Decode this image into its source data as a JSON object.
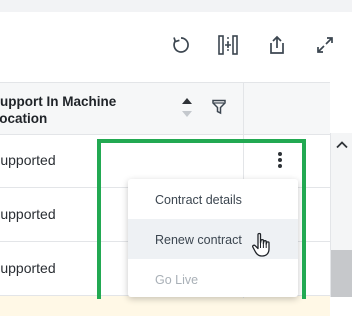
{
  "toolbar": {
    "refresh_icon": "refresh-icon",
    "columns_icon": "column-insert-icon",
    "export_icon": "export-icon",
    "expand_icon": "expand-icon"
  },
  "table": {
    "header": {
      "line1": "Support In Machine",
      "line2": "Location"
    },
    "rows": [
      {
        "status": "Supported"
      },
      {
        "status": "Supported"
      },
      {
        "status": "Supported"
      }
    ]
  },
  "menu": {
    "items": [
      {
        "label": "Contract details"
      },
      {
        "label": "Renew contract"
      },
      {
        "label": "Go Live"
      }
    ]
  },
  "colors": {
    "highlight": "#22a952",
    "icon": "#3c4650",
    "hovered_row": "#eef1f4",
    "warning_row": "#fff8e6"
  }
}
